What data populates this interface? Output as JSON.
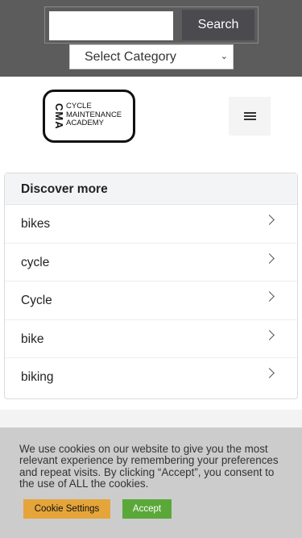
{
  "search": {
    "placeholder": "",
    "value": "",
    "button_label": "Search"
  },
  "category": {
    "selected": "Select Category"
  },
  "logo": {
    "mark": "CMA",
    "lines": [
      "CYCLE",
      "MAINTENANCE",
      "ACADEMY"
    ]
  },
  "discover": {
    "title": "Discover more",
    "items": [
      {
        "label": "bikes"
      },
      {
        "label": "cycle"
      },
      {
        "label": "Cycle"
      },
      {
        "label": "bike"
      },
      {
        "label": "biking"
      }
    ]
  },
  "cookie": {
    "text": "We use cookies on our website to give you the most relevant experience by remembering your preferences and repeat visits. By clicking “Accept”, you consent to the use of ALL the cookies.",
    "settings_label": "Cookie Settings",
    "accept_label": "Accept"
  },
  "colors": {
    "topbar": "#5c5c5c",
    "accept": "#5aa839",
    "settings": "#e5a53a",
    "cookie_bg": "#cccccc"
  },
  "icons": {
    "menu": "hamburger-icon",
    "row_arrow": "chevron-right-icon",
    "select_arrow": "chevron-down-icon"
  }
}
